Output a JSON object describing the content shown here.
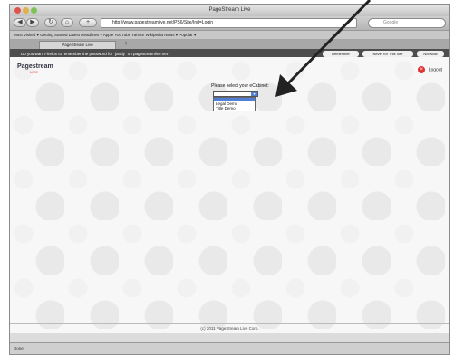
{
  "window": {
    "title": "PageStream Live"
  },
  "navbar": {
    "back_glyph": "◀",
    "forward_glyph": "▶",
    "reload_glyph": "↻",
    "home_glyph": "⌂",
    "plus_glyph": "+",
    "url": "http://www.pagestreamlive.net/PS6/Site/Ind=Login",
    "search_placeholder": "Google"
  },
  "bookmarks": {
    "text": "Most Visited ▾   Getting Started   Latest Headlines ▾   Apple   YouTube   Yahoo!   Wikipedia   News ▾   Popular ▾"
  },
  "tabs": {
    "active_label": "PageStream Live",
    "new_tab_glyph": "+"
  },
  "notification": {
    "message": "Do you want Firefox to remember the password for \"jandy\" on pagestreamlive.net?",
    "buttons": [
      "Remember",
      "Never for This Site",
      "Not Now"
    ]
  },
  "page": {
    "logo_main": "Pagestream",
    "logo_sub": "LIVE",
    "logout_label": "Logout",
    "prompt": "Please select your eCabinet:",
    "select_value": "",
    "options": [
      "",
      "Legal Demo",
      "Title Demo"
    ],
    "footer": "(c) 2011 PageStream Live Corp.",
    "status": "Done"
  },
  "colors": {
    "highlight": "#4f7fd6",
    "notify_bg": "#4d4d4d",
    "logout": "#dd3333"
  }
}
